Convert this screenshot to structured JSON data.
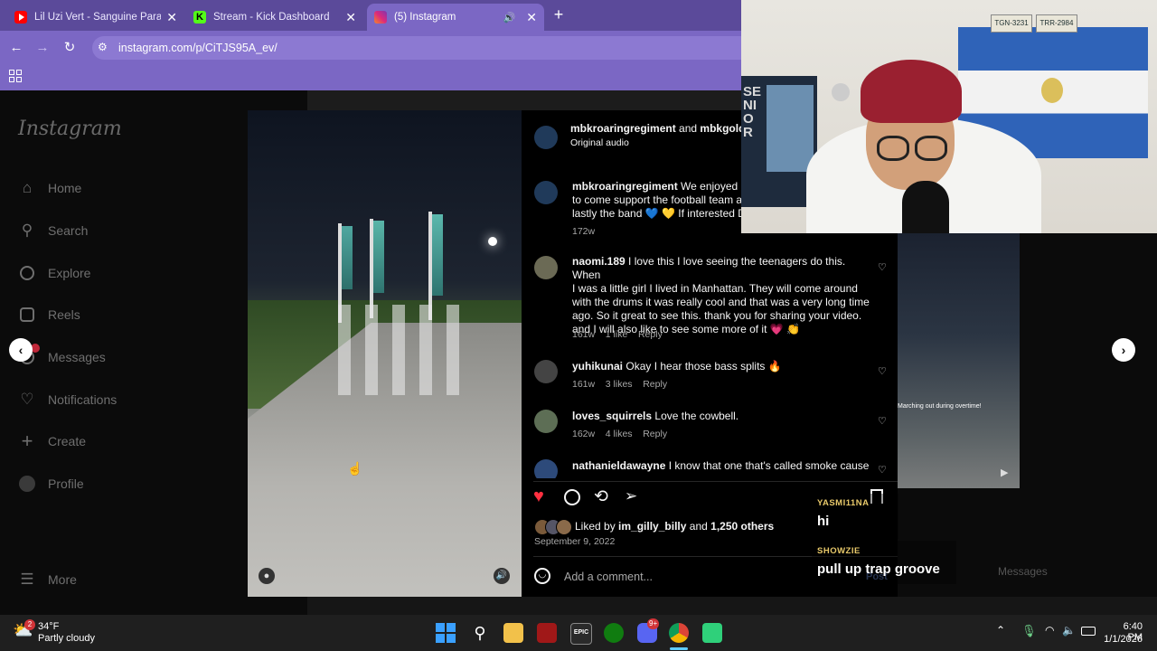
{
  "browser": {
    "tabs": [
      {
        "title": "Lil Uzi Vert - Sanguine Paradise",
        "icon": "youtube-icon",
        "active": false
      },
      {
        "title": "Stream - Kick Dashboard",
        "icon": "kick-icon",
        "active": false
      },
      {
        "title": "(5) Instagram",
        "icon": "instagram-icon",
        "active": true
      }
    ],
    "url": "instagram.com/p/CiTJS95A_ev/"
  },
  "sidebar": {
    "logo": "Instagram",
    "items": [
      {
        "label": "Home",
        "icon": "home-icon"
      },
      {
        "label": "Search",
        "icon": "search-icon"
      },
      {
        "label": "Explore",
        "icon": "compass-icon"
      },
      {
        "label": "Reels",
        "icon": "reels-icon"
      },
      {
        "label": "Messages",
        "icon": "messenger-icon"
      },
      {
        "label": "Notifications",
        "icon": "heart-icon"
      },
      {
        "label": "Create",
        "icon": "plus-icon"
      },
      {
        "label": "Profile",
        "icon": "avatar-icon"
      }
    ],
    "more": "More"
  },
  "post": {
    "header": {
      "user1": "mbkroaringregiment",
      "and": "and",
      "user2": "mbkgolds",
      "audio": "Original audio"
    },
    "caption": {
      "user": "mbkroaringregiment",
      "line1": "We enjoyed ev",
      "line2": "to come support the football team a",
      "line3": "lastly the band 💙 💛  If interested DI",
      "time": "172w"
    },
    "comments": [
      {
        "user": "naomi.189",
        "lines": [
          "I love this I love seeing the teenagers do this. When",
          "I was a little girl I lived in Manhattan. They will come around",
          "with the drums it was really cool and that was a very long time",
          "ago. So it great to see this. thank you for sharing your video.",
          "and I will also like to see some more of it 💗 👏"
        ],
        "time": "161w",
        "likes": "1 like",
        "reply": "Reply"
      },
      {
        "user": "yuhikunai",
        "lines": [
          "Okay I hear those bass splits 🔥"
        ],
        "time": "161w",
        "likes": "3 likes",
        "reply": "Reply"
      },
      {
        "user": "loves_squirrels",
        "lines": [
          "Love the cowbell."
        ],
        "time": "162w",
        "likes": "4 likes",
        "reply": "Reply"
      },
      {
        "user": "nathanieldawayne",
        "lines": [
          "I know that one that's called smoke cause"
        ],
        "time": "",
        "likes": "",
        "reply": ""
      }
    ],
    "liked_by": {
      "prefix": "Liked by",
      "user": "im_gilly_billy",
      "and": "and",
      "others": "1,250 others"
    },
    "date": "September 9, 2022",
    "add_comment": "Add a comment...",
    "post_button": "Post",
    "liked": true,
    "accent": "#ff3040"
  },
  "background": {
    "video_caption": "Marching out during overtime!",
    "messages": "Messages"
  },
  "chat": [
    {
      "user": "YASMI11NA",
      "message": "hi"
    },
    {
      "user": "SHOWZIE",
      "message": "pull up trap groove"
    }
  ],
  "webcam": {
    "plate1": "TGN-3231",
    "plate2": "TRR-2984",
    "poster": "SENIOR"
  },
  "taskbar": {
    "weather_temp": "34°F",
    "weather_desc": "Partly cloudy",
    "weather_badge": "2",
    "discord_badge": "9+",
    "time": "6:40 PM",
    "date": "1/1/2026"
  }
}
